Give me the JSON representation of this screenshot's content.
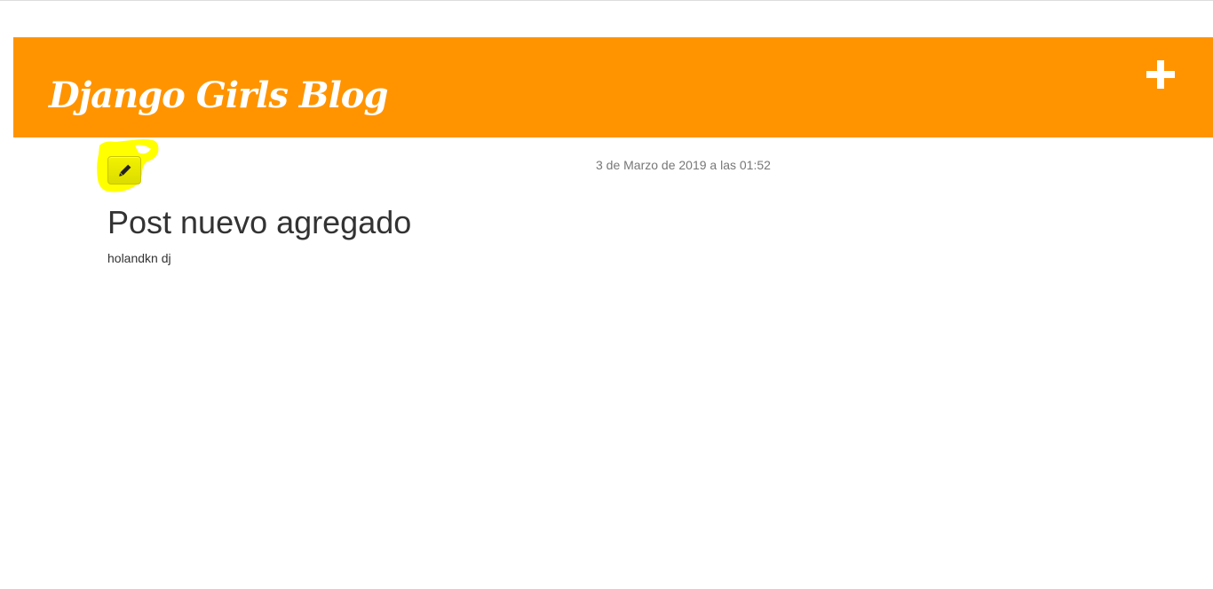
{
  "header": {
    "title": "Django Girls Blog",
    "background_color": "#ff9400",
    "add_icon": "plus-icon"
  },
  "post": {
    "date": "3 de Marzo de 2019 a las 01:52",
    "title": "Post nuevo agregado",
    "text": "holandkn dj",
    "edit_icon": "pencil-icon",
    "highlight_color": "#ffff00"
  }
}
